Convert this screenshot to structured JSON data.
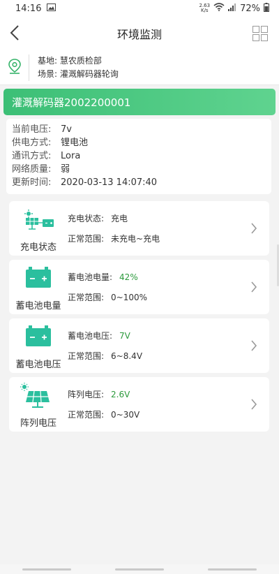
{
  "status": {
    "time": "14:16",
    "speed_value": "2.63",
    "speed_unit": "K/s",
    "battery": "72%"
  },
  "nav": {
    "title": "环境监测"
  },
  "location": {
    "base_label": "基地:",
    "base_value": "慧农质检部",
    "scene_label": "场景:",
    "scene_value": "灌溉解码器轮询"
  },
  "device": {
    "title": "灌溉解码器2002200001"
  },
  "info": {
    "rows": [
      {
        "label": "当前电压:",
        "value": "7v"
      },
      {
        "label": "供电方式:",
        "value": "锂电池"
      },
      {
        "label": "通讯方式:",
        "value": "Lora"
      },
      {
        "label": "网络质量:",
        "value": "弱"
      },
      {
        "label": "更新时间:",
        "value": "2020-03-13 14:07:40"
      }
    ]
  },
  "cards": [
    {
      "name": "充电状态",
      "icon": "solar-charge-icon",
      "status_label": "充电状态:",
      "status_value": "充电",
      "range_label": "正常范围:",
      "range_value": "未充电~充电"
    },
    {
      "name": "蓄电池电量",
      "icon": "battery-icon",
      "status_label": "蓄电池电量:",
      "status_value": "42%",
      "range_label": "正常范围:",
      "range_value": "0~100%"
    },
    {
      "name": "蓄电池电压",
      "icon": "battery-icon",
      "status_label": "蓄电池电压:",
      "status_value": "7V",
      "range_label": "正常范围:",
      "range_value": "6~8.4V"
    },
    {
      "name": "阵列电压",
      "icon": "solar-panel-icon",
      "status_label": "阵列电压:",
      "status_value": "2.6V",
      "range_label": "正常范围:",
      "range_value": "0~30V"
    }
  ],
  "colors": {
    "accent": "#3cbf76",
    "value_green": "#2c9a3c",
    "icon_teal": "#2bbf9e"
  }
}
